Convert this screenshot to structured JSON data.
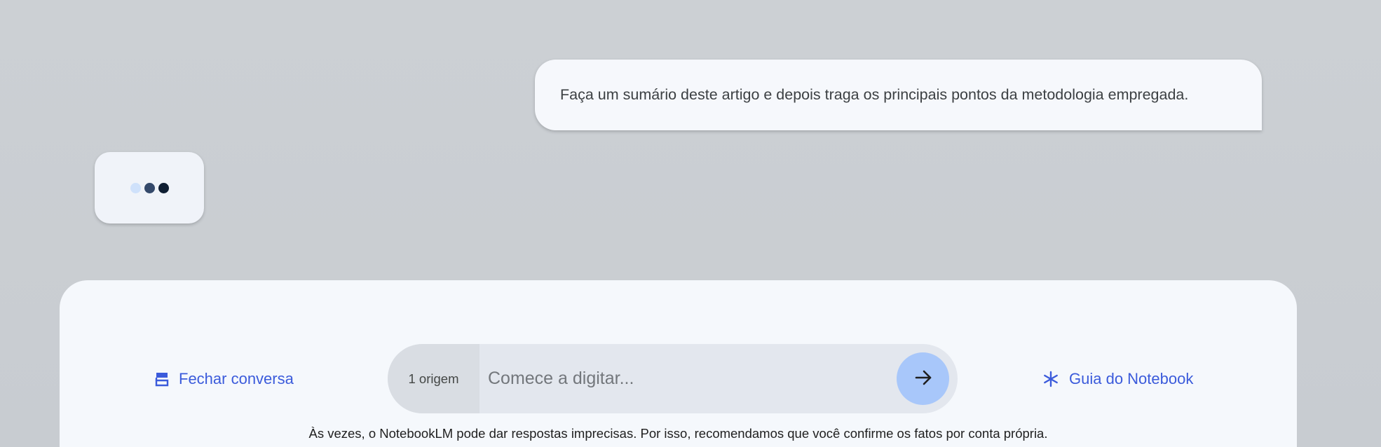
{
  "conversation": {
    "user_message": "Faça um sumário deste artigo e depois traga os principais pontos da metodologia empregada.",
    "typing_indicator": {
      "dot_colors": [
        "#cfe1fb",
        "#34496b",
        "#0f1e33"
      ]
    }
  },
  "composer": {
    "close_chat_label": "Fechar conversa",
    "close_chat_icon": "collapse-chat-icon",
    "sources_chip_label": "1 origem",
    "input_placeholder": "Comece a digitar...",
    "input_value": "",
    "send_icon": "arrow-right-icon",
    "guide_label": "Guia do Notebook",
    "guide_icon": "asterisk-icon",
    "disclaimer": "Às vezes, o NotebookLM pode dar respostas imprecisas. Por isso, recomendamos que você confirme os fatos por conta própria."
  },
  "colors": {
    "accent": "#3b5bdb",
    "send_button": "#a8c7fa",
    "panel": "#f5f8fc",
    "background": "#ccd0d4"
  }
}
